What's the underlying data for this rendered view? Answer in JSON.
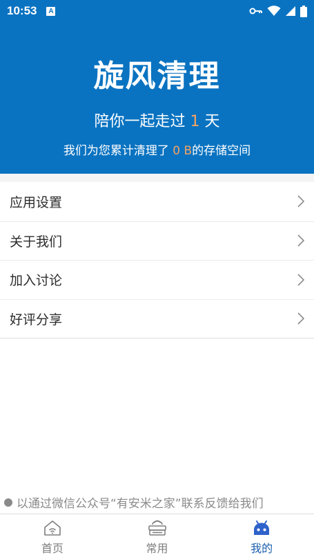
{
  "status_bar": {
    "time": "10:53",
    "a_label": "A"
  },
  "hero": {
    "title": "旋风清理",
    "days_prefix": "陪你一起走过 ",
    "days_value": "1",
    "days_suffix": " 天",
    "storage_prefix": "我们为您累计清理了 ",
    "storage_value": "0 B",
    "storage_suffix": "的存储空间"
  },
  "menu": {
    "items": [
      {
        "label": "应用设置"
      },
      {
        "label": "关于我们"
      },
      {
        "label": "加入讨论"
      },
      {
        "label": "好评分享"
      }
    ]
  },
  "footer_note": "以通过微信公众号“有安米之家”联系反馈给我们",
  "tabs": [
    {
      "label": "首页",
      "icon": "home-icon",
      "active": false
    },
    {
      "label": "常用",
      "icon": "toolbox-icon",
      "active": false
    },
    {
      "label": "我的",
      "icon": "android-icon",
      "active": true
    }
  ],
  "colors": {
    "primary": "#0a73c1",
    "accent": "#f5a462",
    "active_tab": "#1d5fae"
  }
}
